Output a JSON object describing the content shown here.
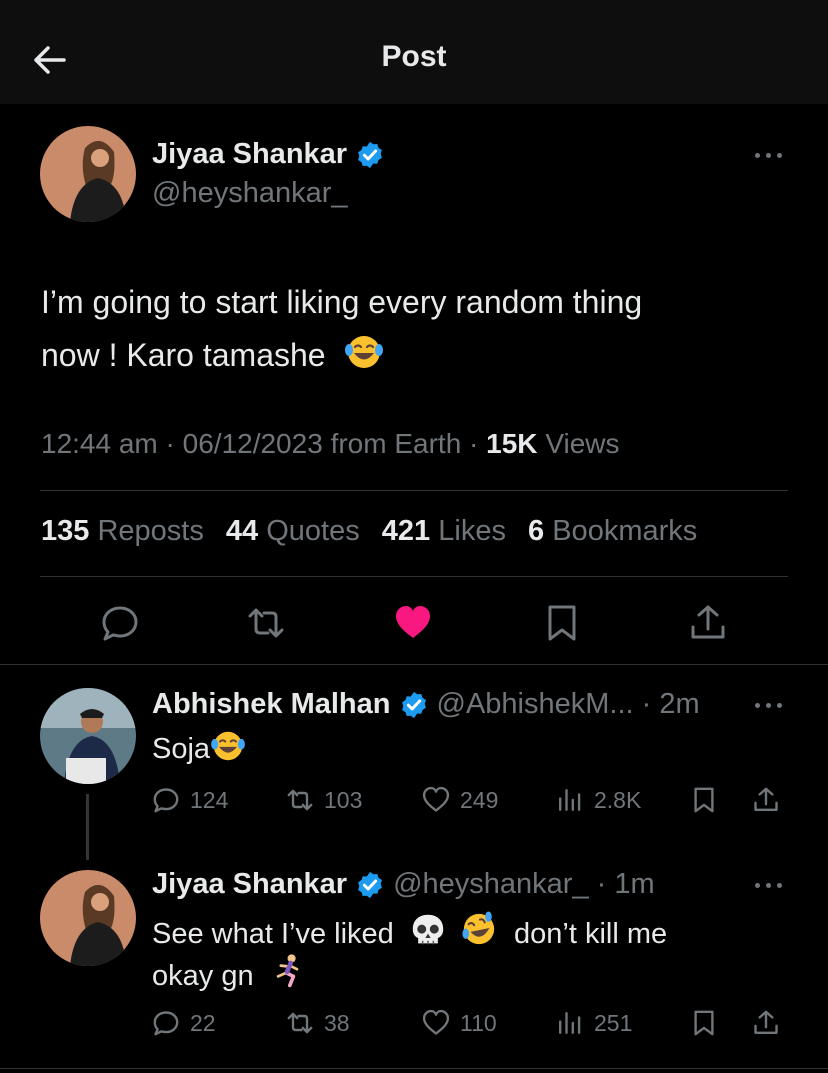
{
  "header": {
    "title": "Post"
  },
  "post": {
    "author_name": "Jiyaa Shankar",
    "handle": "@heyshankar_",
    "text_line1": "I’m going to start liking every random thing",
    "text_line2": "now ! Karo tamashe",
    "time": "12:44 am",
    "date": "06/12/2023",
    "from_label": "from Earth",
    "views_count": "15K",
    "views_label": "Views",
    "stats": {
      "reposts_count": "135",
      "reposts_label": "Reposts",
      "quotes_count": "44",
      "quotes_label": "Quotes",
      "likes_count": "421",
      "likes_label": "Likes",
      "bookmarks_count": "6",
      "bookmarks_label": "Bookmarks"
    },
    "liked": true
  },
  "replies": [
    {
      "author_name": "Abhishek Malhan",
      "handle": "@AbhishekM...",
      "time": "2m",
      "text": "Soja",
      "reply_count": "124",
      "repost_count": "103",
      "like_count": "249",
      "views_count": "2.8K"
    },
    {
      "author_name": "Jiyaa Shankar",
      "handle": "@heyshankar_",
      "time": "1m",
      "text_part1": "See what I’ve liked",
      "text_part2": "don’t kill me",
      "text_line2": "okay gn",
      "reply_count": "22",
      "repost_count": "38",
      "like_count": "110",
      "views_count": "251"
    }
  ],
  "colors": {
    "background": "#000000",
    "text": "#e7e9ea",
    "secondary": "#71767b",
    "verified": "#1d9bf0",
    "like": "#f91880",
    "divider": "#2f3336"
  }
}
